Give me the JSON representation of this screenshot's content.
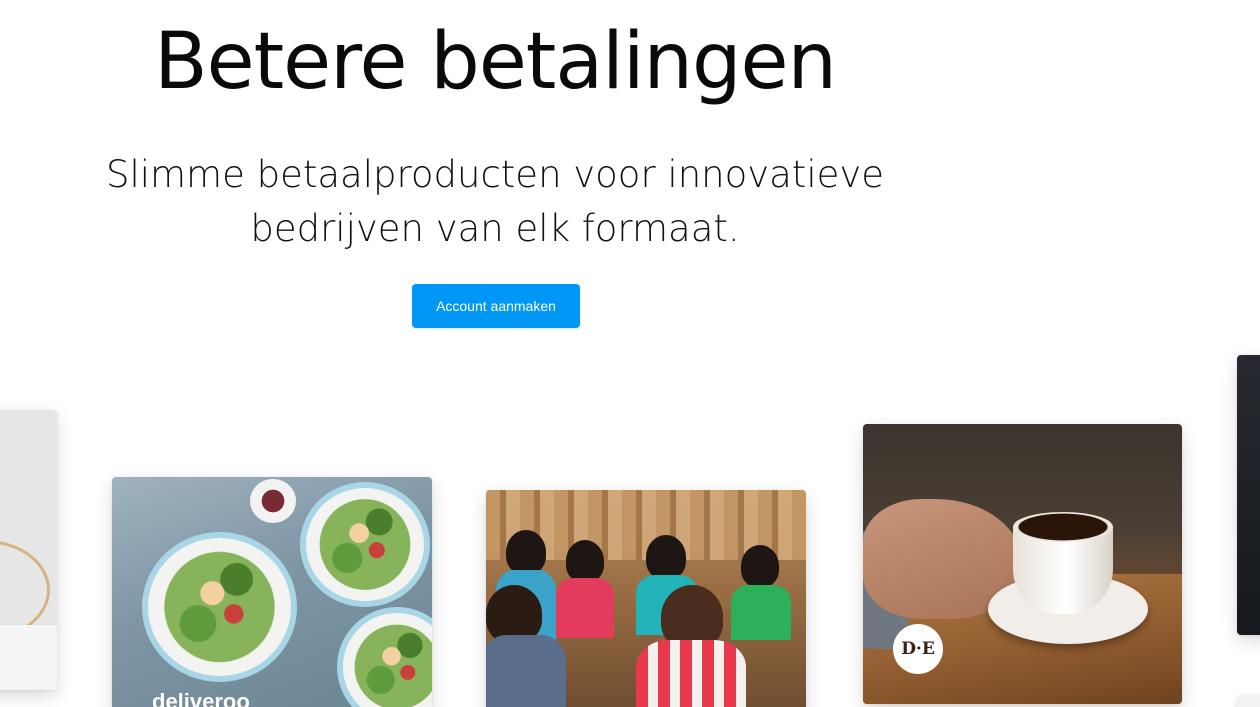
{
  "hero": {
    "title": "Betere betalingen",
    "subtitle": "Slimme betaalproducten voor innovatieve bedrijven van elk formaat.",
    "cta_label": "Account aanmaken"
  },
  "cards": {
    "food": {
      "logo_text": "deliveroo"
    },
    "coffee": {
      "logo_text": "D·E"
    }
  },
  "colors": {
    "cta_background": "#0097f6",
    "title_text": "#0a0a0a"
  }
}
